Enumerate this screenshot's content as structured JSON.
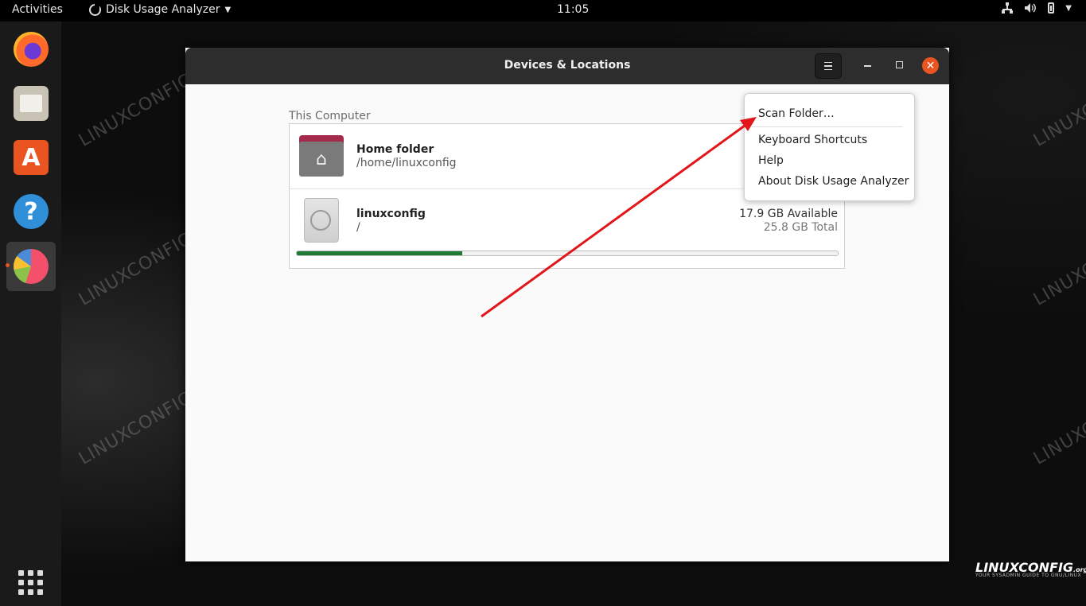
{
  "topbar": {
    "activities": "Activities",
    "app_name": "Disk Usage Analyzer",
    "clock": "11:05"
  },
  "dock": {
    "items": [
      {
        "name": "Firefox",
        "icon": "firefox-icon"
      },
      {
        "name": "Files",
        "icon": "files-icon"
      },
      {
        "name": "Ubuntu Software",
        "icon": "software-store-icon"
      },
      {
        "name": "Help",
        "icon": "help-icon"
      },
      {
        "name": "Disk Usage Analyzer",
        "icon": "disk-usage-analyzer-icon",
        "active": true
      }
    ],
    "show_apps_icon": "apps-grid-icon"
  },
  "window": {
    "title": "Devices & Locations",
    "close_glyph": "✕",
    "section_label": "This Computer",
    "devices": [
      {
        "name": "Home folder",
        "path": "/home/linuxconfig"
      },
      {
        "name": "linuxconfig",
        "path": "/",
        "available": "17.9 GB Available",
        "total": "25.8 GB Total",
        "used_fraction": 0.306
      }
    ]
  },
  "popup_menu": {
    "items": [
      "Scan Folder…",
      "Keyboard Shortcuts",
      "Help",
      "About Disk Usage Analyzer"
    ]
  },
  "watermark": "LINUXCONFIG.ORG",
  "brand": {
    "name": "LINUXCONFIG",
    "suffix": ".org",
    "tagline": "YOUR SYSADMIN GUIDE TO GNU/LINUX"
  },
  "colors": {
    "accent": "#e95420",
    "usage_bar": "#1e7a34",
    "annotation_arrow": "#e0161b"
  }
}
